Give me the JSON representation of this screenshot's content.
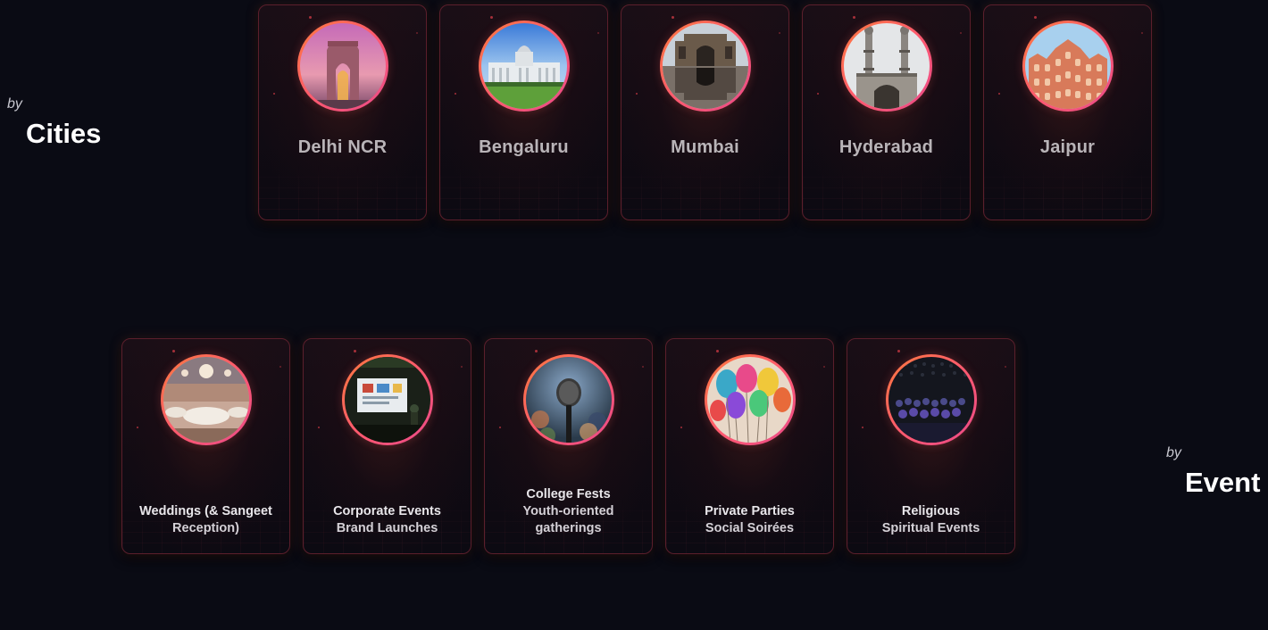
{
  "cities_section": {
    "by": "by",
    "title": "Cities",
    "cards": [
      {
        "name": "Delhi NCR",
        "icon": "india-gate-photo"
      },
      {
        "name": "Bengaluru",
        "icon": "vidhana-soudha-photo"
      },
      {
        "name": "Mumbai",
        "icon": "gateway-of-india-photo"
      },
      {
        "name": "Hyderabad",
        "icon": "charminar-photo"
      },
      {
        "name": "Jaipur",
        "icon": "hawa-mahal-photo"
      }
    ]
  },
  "events_section": {
    "by": "by",
    "title": "Event",
    "cards": [
      {
        "line1": "Weddings (& Sangeet",
        "line2": "Reception)",
        "icon": "wedding-hall-photo"
      },
      {
        "line1": "Corporate Events",
        "line2": "Brand Launches",
        "icon": "presentation-screen-photo"
      },
      {
        "line1": "College Fests",
        "line2": "Youth-oriented",
        "line3": "gatherings",
        "icon": "microphone-crowd-photo"
      },
      {
        "line1": "Private Parties",
        "line2": "Social Soirées",
        "icon": "balloons-photo"
      },
      {
        "line1": "Religious",
        "line2": "Spiritual Events",
        "icon": "audience-hall-photo"
      }
    ]
  },
  "colors": {
    "background": "#0a0b14",
    "card_border": "#5b1f2c",
    "ring_start": "#ff7a3d",
    "ring_end": "#e94a8a"
  }
}
